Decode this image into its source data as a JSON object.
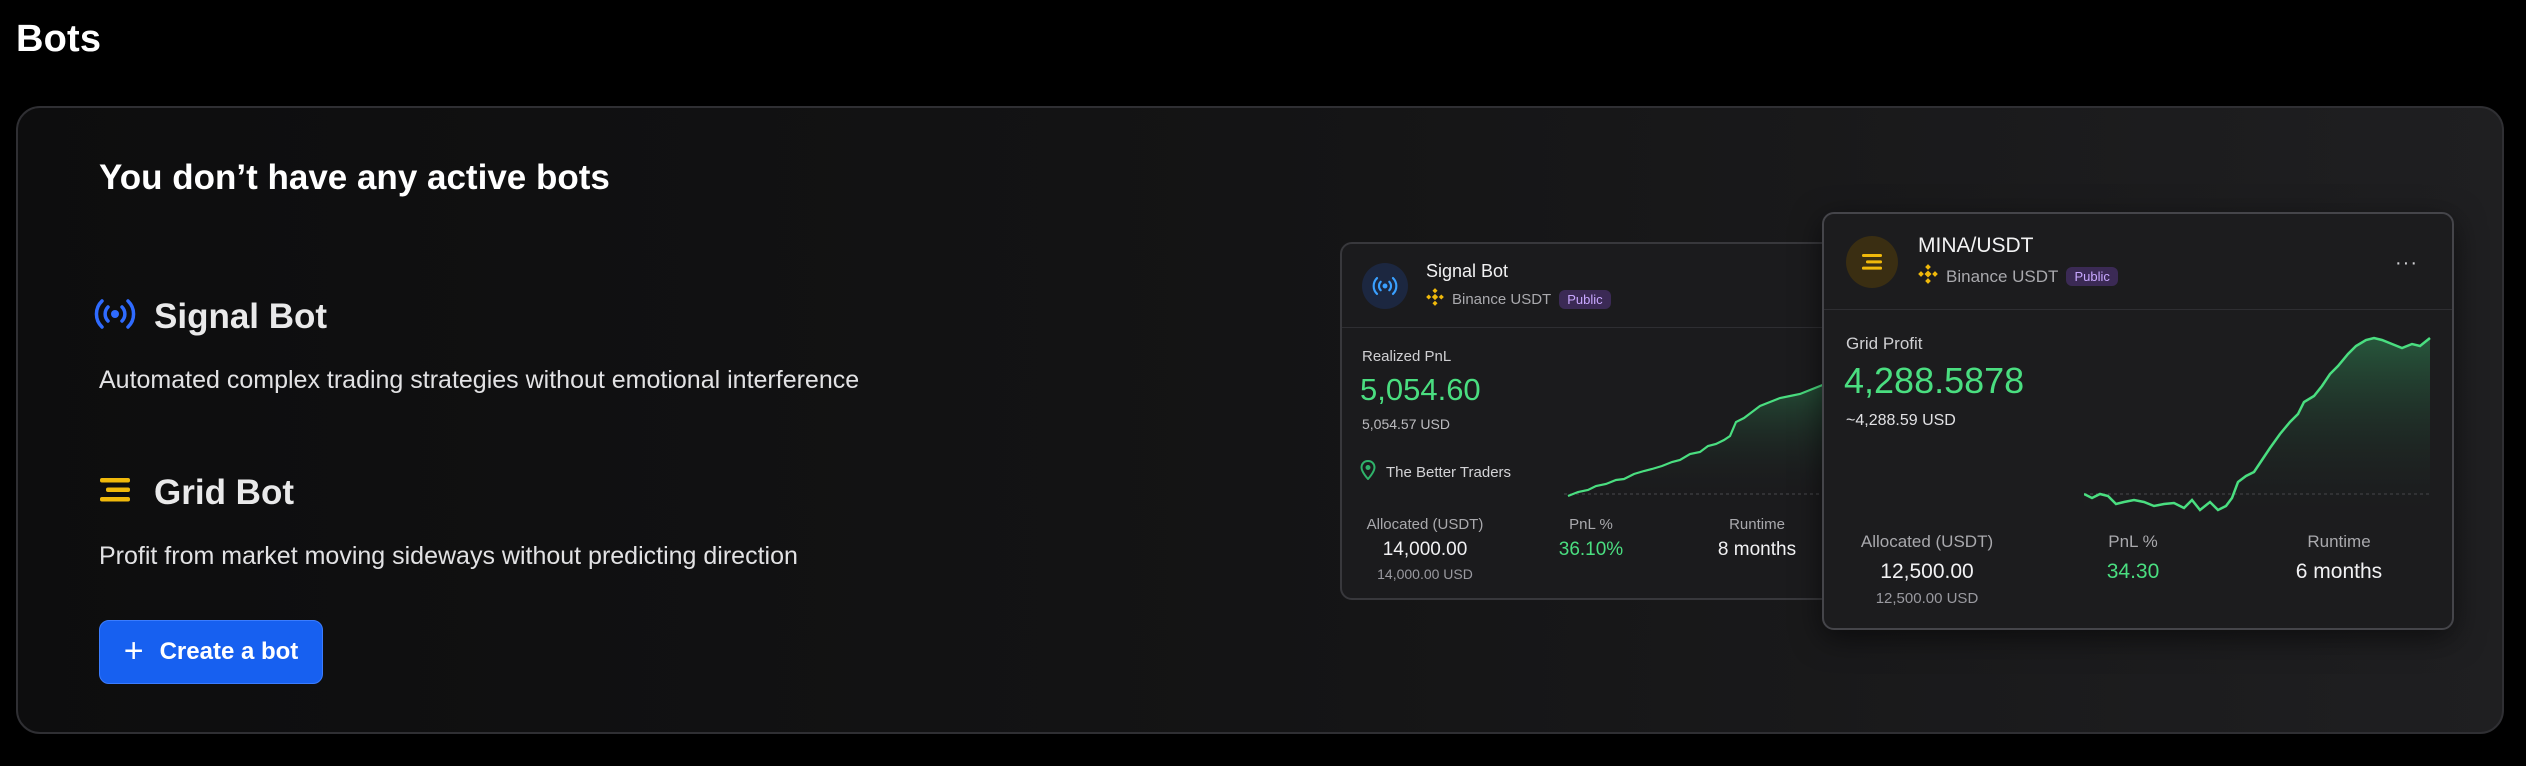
{
  "page": {
    "title": "Bots"
  },
  "empty_state": {
    "title": "You don’t have any active bots",
    "features": [
      {
        "name": "Signal Bot",
        "icon": "signal-broadcast-icon",
        "description": "Automated complex trading strategies without emotional interference"
      },
      {
        "name": "Grid Bot",
        "icon": "grid-lines-icon",
        "description": "Profit from market moving sideways without predicting direction"
      }
    ],
    "create_button": {
      "label": "Create a bot",
      "icon": "plus-icon"
    }
  },
  "preview_cards": {
    "signal": {
      "title": "Signal Bot",
      "exchange": "Binance USDT",
      "badge": "Public",
      "metric_label": "Realized PnL",
      "metric_value": "5,054.60",
      "metric_sub": "5,054.57 USD",
      "provider": "The Better Traders",
      "stats": [
        {
          "label": "Allocated (USDT)",
          "value": "14,000.00",
          "sub": "14,000.00 USD"
        },
        {
          "label": "PnL %",
          "value": "36.10%",
          "sub": ""
        },
        {
          "label": "Runtime",
          "value": "8 months",
          "sub": ""
        }
      ]
    },
    "grid": {
      "title": "MINA/USDT",
      "exchange": "Binance USDT",
      "badge": "Public",
      "more": "···",
      "metric_label": "Grid Profit",
      "metric_value": "4,288.5878",
      "metric_sub": "~4,288.59 USD",
      "stats": [
        {
          "label": "Allocated (USDT)",
          "value": "12,500.00",
          "sub": "12,500.00 USD"
        },
        {
          "label": "PnL %",
          "value": "34.30",
          "sub": ""
        },
        {
          "label": "Runtime",
          "value": "6 months",
          "sub": ""
        }
      ]
    }
  },
  "colors": {
    "accent_blue": "#1760f0",
    "signal_icon": "#2f6bff",
    "grid_icon": "#f0b90b",
    "positive": "#4ade80"
  }
}
